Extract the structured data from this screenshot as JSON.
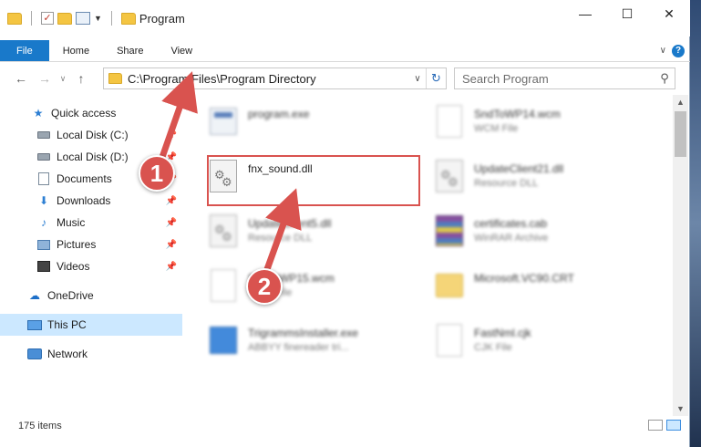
{
  "window": {
    "title": "Program",
    "controls": {
      "minimize": "—",
      "maximize": "☐",
      "close": "✕"
    }
  },
  "ribbon": {
    "tabs": [
      "File",
      "Home",
      "Share",
      "View"
    ],
    "help": "?"
  },
  "address": {
    "path": "C:\\Program Files\\Program Directory",
    "search_placeholder": "Search Program"
  },
  "sidebar": {
    "items": [
      {
        "label": "Quick access",
        "icon": "star-icon",
        "pinned": false
      },
      {
        "label": "Local Disk (C:)",
        "icon": "drive-icon",
        "pinned": true
      },
      {
        "label": "Local Disk (D:)",
        "icon": "drive-icon",
        "pinned": true
      },
      {
        "label": "Documents",
        "icon": "documents-icon",
        "pinned": true
      },
      {
        "label": "Downloads",
        "icon": "download-icon",
        "pinned": true
      },
      {
        "label": "Music",
        "icon": "music-icon",
        "pinned": true
      },
      {
        "label": "Pictures",
        "icon": "pictures-icon",
        "pinned": true
      },
      {
        "label": "Videos",
        "icon": "videos-icon",
        "pinned": true
      },
      {
        "label": "OneDrive",
        "icon": "onedrive-icon",
        "pinned": false
      },
      {
        "label": "This PC",
        "icon": "computer-icon",
        "pinned": false,
        "selected": true
      },
      {
        "label": "Network",
        "icon": "network-icon",
        "pinned": false
      }
    ]
  },
  "files": [
    {
      "name": "program.exe",
      "type": "",
      "icon": "exe-icon",
      "blurred": true
    },
    {
      "name": "SndToWP14.wcm",
      "type": "WCM File",
      "icon": "document-icon",
      "blurred": true
    },
    {
      "name": "fnx_sound.dll",
      "type": "",
      "icon": "dll-icon",
      "blurred": false,
      "highlighted": true
    },
    {
      "name": "UpdateClient21.dll",
      "type": "Resource DLL",
      "icon": "dll-icon",
      "blurred": true
    },
    {
      "name": "UpdateClient5.dll",
      "type": "Resource DLL",
      "icon": "dll-icon",
      "blurred": true
    },
    {
      "name": "certificates.cab",
      "type": "WinRAR Archive",
      "icon": "archive-icon",
      "blurred": true
    },
    {
      "name": "SndToWP15.wcm",
      "type": "WCM File",
      "icon": "document-icon",
      "blurred": true
    },
    {
      "name": "Microsoft.VC90.CRT",
      "type": "",
      "icon": "folder-icon",
      "blurred": true
    },
    {
      "name": "TrigrammsInstaller.exe",
      "type": "ABBYY finereader tri...",
      "icon": "installer-icon",
      "blurred": true
    },
    {
      "name": "FastNml.cjk",
      "type": "CJK File",
      "icon": "document-icon",
      "blurred": true
    }
  ],
  "status": {
    "count": "175 items"
  },
  "annotations": [
    {
      "number": "1",
      "target": "address-bar"
    },
    {
      "number": "2",
      "target": "fnx_sound.dll"
    }
  ],
  "colors": {
    "accent": "#1979ca",
    "selection": "#cce8ff",
    "annotation": "#d9534f"
  }
}
